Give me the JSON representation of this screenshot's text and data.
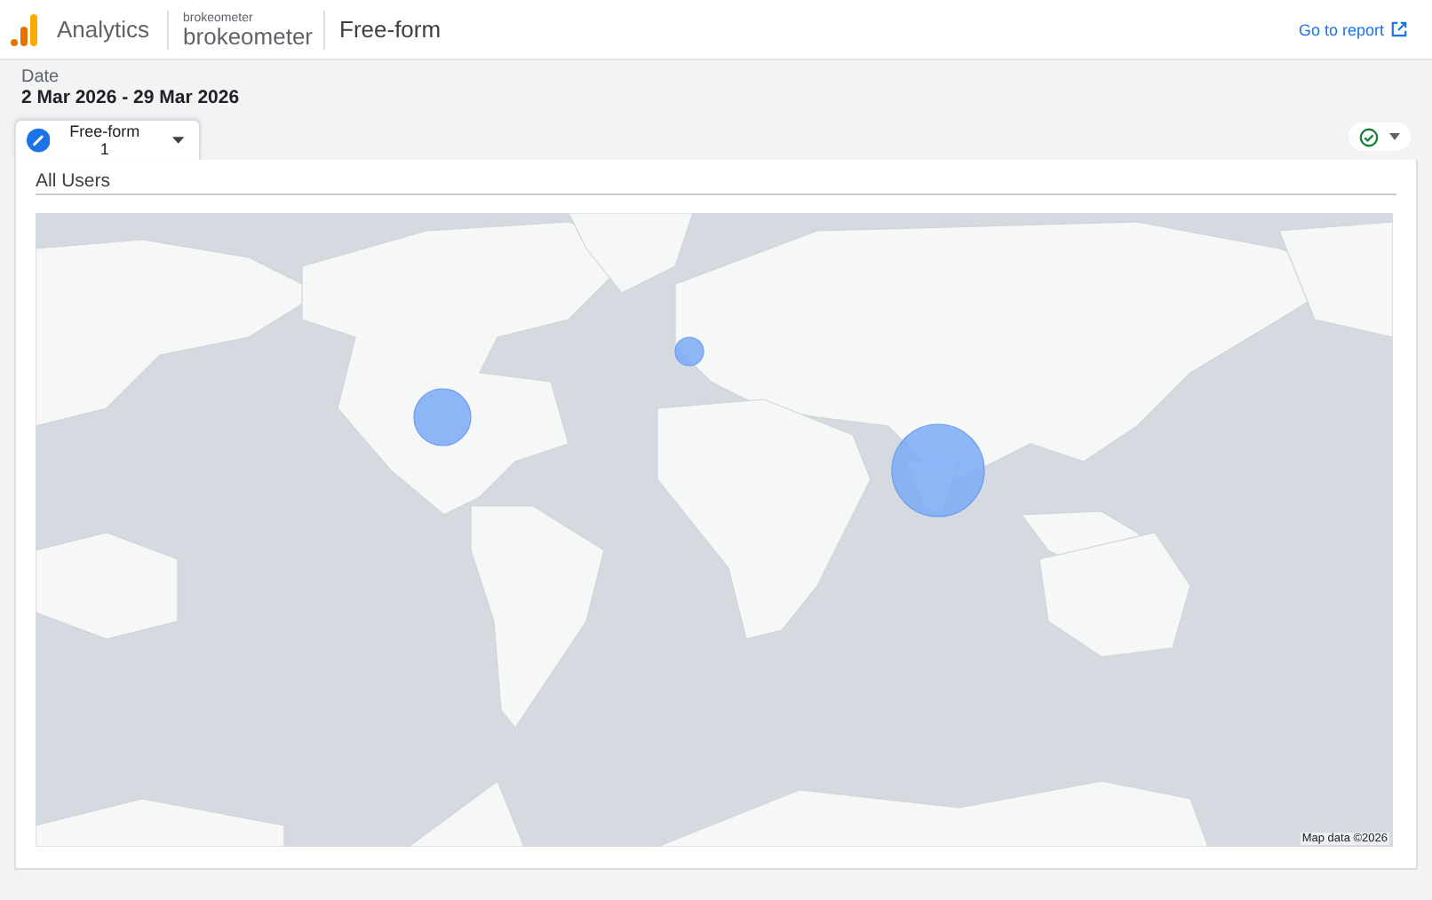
{
  "header": {
    "product": "Analytics",
    "account": "brokeometer",
    "property": "brokeometer",
    "page_title": "Free-form",
    "report_link": "Go to report"
  },
  "date": {
    "label": "Date",
    "range": "2 Mar 2026 - 29 Mar 2026"
  },
  "tabs": [
    {
      "label": "Free-form 1",
      "selected": true
    }
  ],
  "status": {
    "ok": true
  },
  "card": {
    "title": "All Users",
    "map_credit": "Map data ©2026"
  }
}
